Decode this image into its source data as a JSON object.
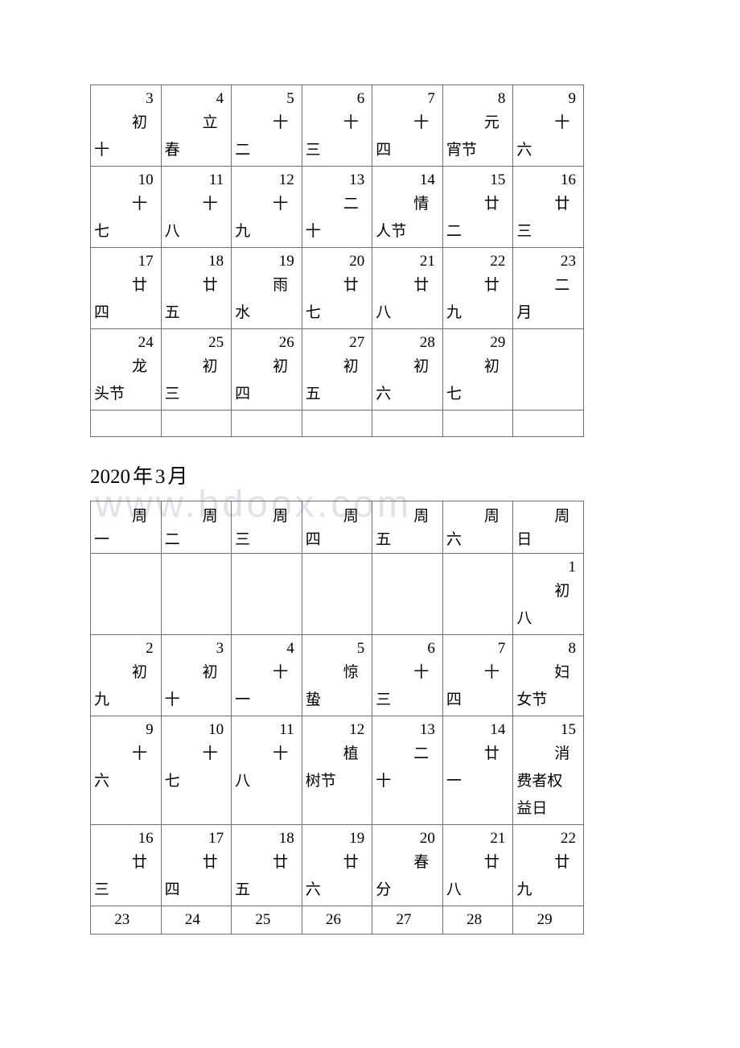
{
  "page": {
    "watermark": "www.bdoox.com",
    "watermark_color": "#e2e1ea",
    "background_color": "#ffffff",
    "border_color": "#6f6f6f"
  },
  "months": [
    {
      "id": "february",
      "title": null,
      "title_year": null,
      "title_month": null,
      "show_header": false,
      "weekdays": [],
      "weeks": [
        [
          {
            "day": "3",
            "lunar": "初十"
          },
          {
            "day": "4",
            "lunar": "立春"
          },
          {
            "day": "5",
            "lunar": "十二"
          },
          {
            "day": "6",
            "lunar": "十三"
          },
          {
            "day": "7",
            "lunar": "十四"
          },
          {
            "day": "8",
            "lunar": "元宵节"
          },
          {
            "day": "9",
            "lunar": "十六"
          }
        ],
        [
          {
            "day": "10",
            "lunar": "十七"
          },
          {
            "day": "11",
            "lunar": "十八"
          },
          {
            "day": "12",
            "lunar": "十九"
          },
          {
            "day": "13",
            "lunar": "二十"
          },
          {
            "day": "14",
            "lunar": "情人节"
          },
          {
            "day": "15",
            "lunar": "廿二"
          },
          {
            "day": "16",
            "lunar": "廿三"
          }
        ],
        [
          {
            "day": "17",
            "lunar": "廿四"
          },
          {
            "day": "18",
            "lunar": "廿五"
          },
          {
            "day": "19",
            "lunar": "雨水"
          },
          {
            "day": "20",
            "lunar": "廿七"
          },
          {
            "day": "21",
            "lunar": "廿八"
          },
          {
            "day": "22",
            "lunar": "廿九"
          },
          {
            "day": "23",
            "lunar": "二月"
          }
        ],
        [
          {
            "day": "24",
            "lunar": "龙头节"
          },
          {
            "day": "25",
            "lunar": "初三"
          },
          {
            "day": "26",
            "lunar": "初四"
          },
          {
            "day": "27",
            "lunar": "初五"
          },
          {
            "day": "28",
            "lunar": "初六"
          },
          {
            "day": "29",
            "lunar": "初七"
          },
          {
            "day": "",
            "lunar": ""
          }
        ],
        [
          {
            "day": "",
            "lunar": ""
          },
          {
            "day": "",
            "lunar": ""
          },
          {
            "day": "",
            "lunar": ""
          },
          {
            "day": "",
            "lunar": ""
          },
          {
            "day": "",
            "lunar": ""
          },
          {
            "day": "",
            "lunar": ""
          },
          {
            "day": "",
            "lunar": ""
          }
        ]
      ]
    },
    {
      "id": "march",
      "title": "2020年3月",
      "title_year": "2020",
      "title_nian": "年",
      "title_month": "3",
      "title_yue": "月",
      "show_header": true,
      "weekdays": [
        "周一",
        "周二",
        "周三",
        "周四",
        "周五",
        "周六",
        "周日"
      ],
      "weeks": [
        [
          {
            "day": "",
            "lunar": ""
          },
          {
            "day": "",
            "lunar": ""
          },
          {
            "day": "",
            "lunar": ""
          },
          {
            "day": "",
            "lunar": ""
          },
          {
            "day": "",
            "lunar": ""
          },
          {
            "day": "",
            "lunar": ""
          },
          {
            "day": "1",
            "lunar": "初八"
          }
        ],
        [
          {
            "day": "2",
            "lunar": "初九"
          },
          {
            "day": "3",
            "lunar": "初十"
          },
          {
            "day": "4",
            "lunar": "十一"
          },
          {
            "day": "5",
            "lunar": "惊蛰"
          },
          {
            "day": "6",
            "lunar": "十三"
          },
          {
            "day": "7",
            "lunar": "十四"
          },
          {
            "day": "8",
            "lunar": "妇女节"
          }
        ],
        [
          {
            "day": "9",
            "lunar": "十六"
          },
          {
            "day": "10",
            "lunar": "十七"
          },
          {
            "day": "11",
            "lunar": "十八"
          },
          {
            "day": "12",
            "lunar": "植树节"
          },
          {
            "day": "13",
            "lunar": "二十"
          },
          {
            "day": "14",
            "lunar": "廿一"
          },
          {
            "day": "15",
            "lunar": "消费者权益日"
          }
        ],
        [
          {
            "day": "16",
            "lunar": "廿三"
          },
          {
            "day": "17",
            "lunar": "廿四"
          },
          {
            "day": "18",
            "lunar": "廿五"
          },
          {
            "day": "19",
            "lunar": "廿六"
          },
          {
            "day": "20",
            "lunar": "春分"
          },
          {
            "day": "21",
            "lunar": "廿八"
          },
          {
            "day": "22",
            "lunar": "廿九"
          }
        ],
        [
          {
            "day": "23",
            "lunar": ""
          },
          {
            "day": "24",
            "lunar": ""
          },
          {
            "day": "25",
            "lunar": ""
          },
          {
            "day": "26",
            "lunar": ""
          },
          {
            "day": "27",
            "lunar": ""
          },
          {
            "day": "28",
            "lunar": ""
          },
          {
            "day": "29",
            "lunar": ""
          }
        ]
      ]
    }
  ]
}
